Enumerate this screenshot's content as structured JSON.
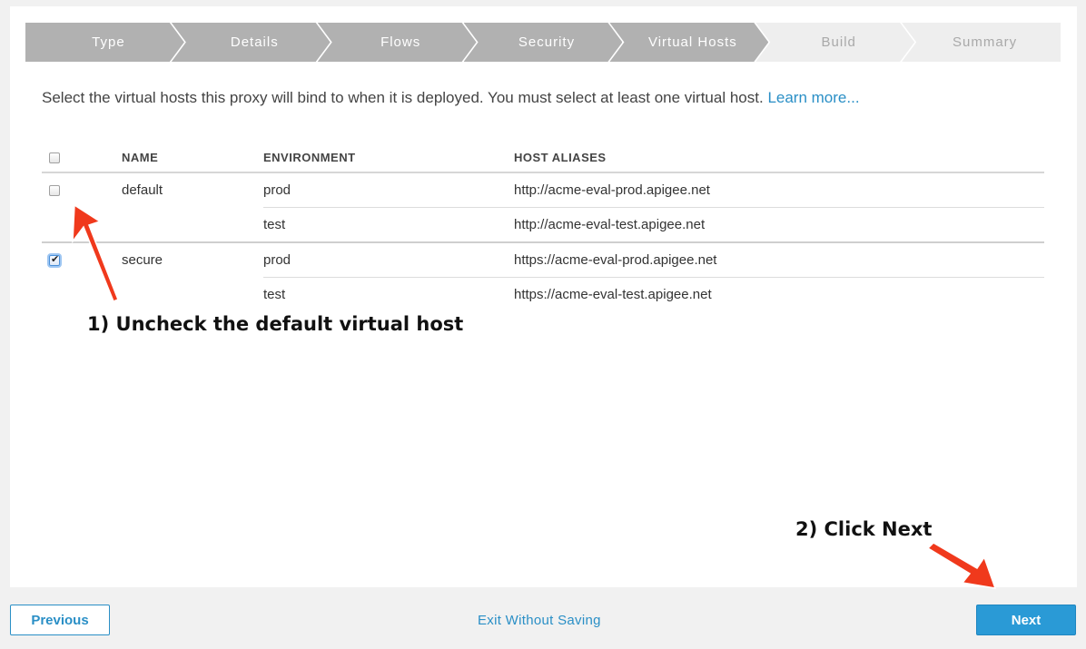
{
  "wizard": {
    "steps": [
      {
        "label": "Type",
        "state": "done"
      },
      {
        "label": "Details",
        "state": "done"
      },
      {
        "label": "Flows",
        "state": "done"
      },
      {
        "label": "Security",
        "state": "done"
      },
      {
        "label": "Virtual Hosts",
        "state": "current"
      },
      {
        "label": "Build",
        "state": "todo"
      },
      {
        "label": "Summary",
        "state": "todo"
      }
    ]
  },
  "intro": {
    "text": "Select the virtual hosts this proxy will bind to when it is deployed. You must select at least one virtual host. ",
    "link": "Learn more..."
  },
  "table": {
    "headers": {
      "name": "NAME",
      "environment": "ENVIRONMENT",
      "aliases": "HOST ALIASES"
    },
    "hosts": [
      {
        "name": "default",
        "checked": false,
        "rows": [
          {
            "environment": "prod",
            "alias": "http://acme-eval-prod.apigee.net"
          },
          {
            "environment": "test",
            "alias": "http://acme-eval-test.apigee.net"
          }
        ]
      },
      {
        "name": "secure",
        "checked": true,
        "rows": [
          {
            "environment": "prod",
            "alias": "https://acme-eval-prod.apigee.net"
          },
          {
            "environment": "test",
            "alias": "https://acme-eval-test.apigee.net"
          }
        ]
      }
    ]
  },
  "annotations": {
    "step1": "1) Uncheck the default virtual host",
    "step2": "2) Click Next",
    "arrow_color": "#f0391c"
  },
  "footer": {
    "previous": "Previous",
    "exit": "Exit Without Saving",
    "next": "Next"
  },
  "colors": {
    "accent": "#2a8fc6",
    "step_done": "#b1b1b1",
    "step_todo": "#eeeeee"
  }
}
